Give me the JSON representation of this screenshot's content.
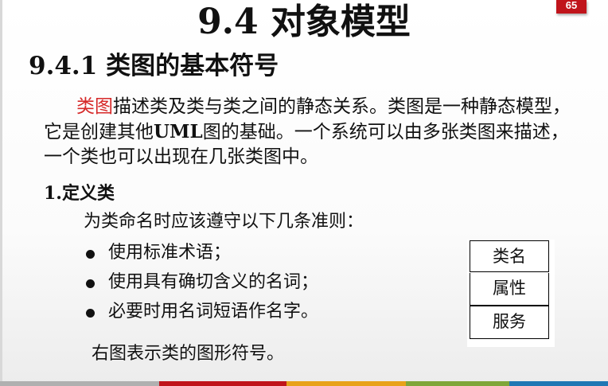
{
  "page_number": "65",
  "title": "9.4 对象模型",
  "subtitle": "9.4.1 类图的基本符号",
  "paragraph": {
    "highlight": "类图",
    "text_1": "描述类及类与类之间的静态关系。类图是一种静态模型，它是创建其他",
    "bold": "UML",
    "text_2": "图的基础。一个系统可以由多张类图来描述，一个类也可以出现在几张类图中。"
  },
  "section_heading": "1.定义类",
  "intro": "为类命名时应该遵守以下几条准则：",
  "bullets": [
    "使用标准术语；",
    "使用具有确切含义的名词；",
    "必要时用名词短语作名字。"
  ],
  "caption": "右图表示类的图形符号。",
  "class_symbol": {
    "name": "类名",
    "attributes": "属性",
    "operations": "服务"
  },
  "colors": {
    "badge": "#c0141b",
    "highlight_text": "#d62828",
    "bottom_bar": [
      "#b0b0b0",
      "#c0141b",
      "#e8a21a",
      "#7fa63a",
      "#1f77b4"
    ]
  }
}
